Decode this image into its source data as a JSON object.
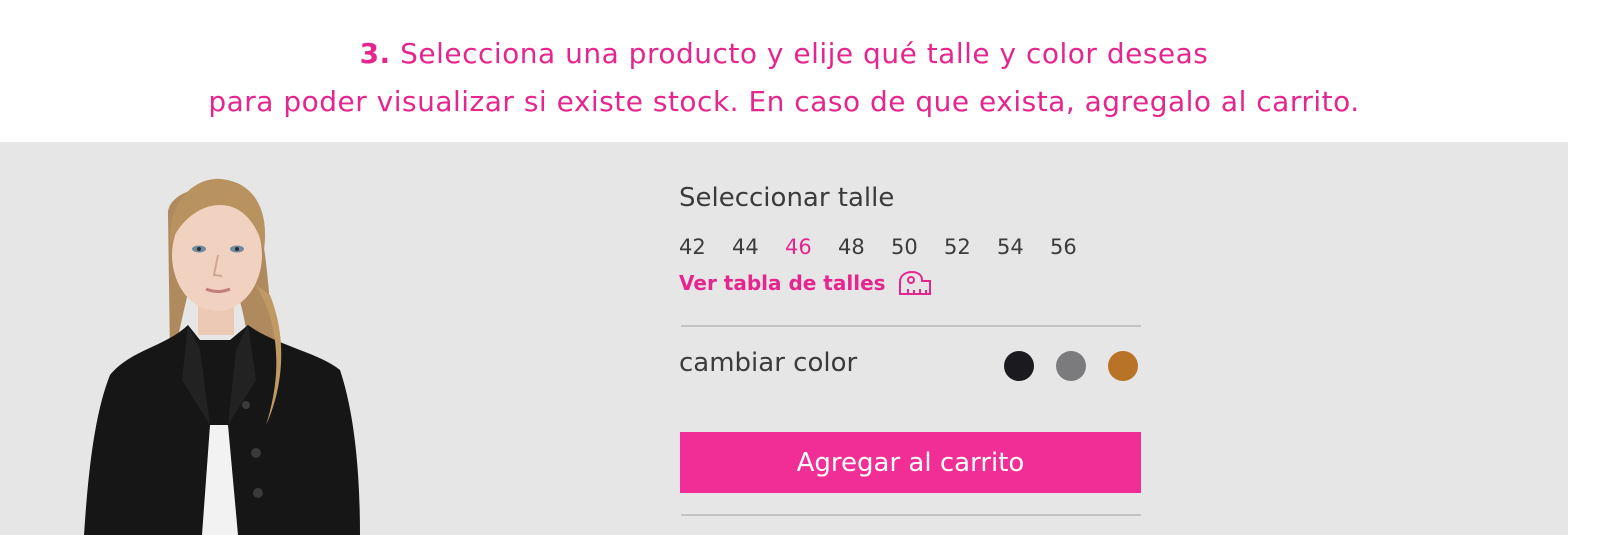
{
  "instructions": {
    "step_number": "3.",
    "line1_text": " Selecciona una producto y elije qué talle y color deseas",
    "line2_text": "para poder visualizar si existe stock. En caso de que exista, agregalo al carrito."
  },
  "product": {
    "image_icon": "woman-black-coat-photo"
  },
  "size_selector": {
    "title": "Seleccionar talle",
    "sizes": [
      "42",
      "44",
      "46",
      "48",
      "50",
      "52",
      "54",
      "56"
    ],
    "selected": "46",
    "table_link": "Ver tabla de talles",
    "table_icon": "measuring-tape-icon"
  },
  "color_selector": {
    "label": "cambiar color",
    "colors": [
      {
        "name": "black",
        "hex": "#1b1a1f"
      },
      {
        "name": "gray",
        "hex": "#7b7b7d"
      },
      {
        "name": "camel",
        "hex": "#b87327"
      }
    ]
  },
  "cart": {
    "add_label": "Agregar al carrito"
  },
  "theme": {
    "accent": "#e5268f",
    "button": "#f12e96",
    "panel_bg": "#e6e6e6",
    "text": "#3b3b3b"
  }
}
